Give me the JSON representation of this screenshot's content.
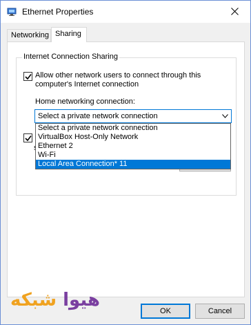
{
  "window": {
    "title": "Ethernet Properties",
    "icon": "network-adapter-icon",
    "close": "close-icon"
  },
  "tabs": [
    {
      "label": "Networking",
      "active": false
    },
    {
      "label": "Sharing",
      "active": true
    }
  ],
  "sharing": {
    "group_label": "Internet Connection Sharing",
    "allow_checked": true,
    "allow_label": "Allow other network users to connect through this computer's Internet connection",
    "home_label": "Home networking connection:",
    "combo_value": "Select a private network connection",
    "second_checked": true,
    "obscured_text_1": "A",
    "obscured_text_2": "s",
    "dropdown_options": [
      "Select a private network connection",
      "VirtualBox Host-Only Network",
      "Ethernet 2",
      "Wi-Fi",
      "Local Area Connection* 11"
    ],
    "dropdown_highlighted_index": 4
  },
  "watermark": {
    "part1": "هیوا",
    "part2": "شبکه",
    "colors": {
      "primary": "#f0a21f",
      "secondary": "#7a3fa0"
    }
  },
  "buttons": {
    "ok": "OK",
    "cancel": "Cancel"
  },
  "colors": {
    "accent": "#0078d7",
    "dialog_bg": "#f0f0f0",
    "button_bg": "#e1e1e1"
  }
}
